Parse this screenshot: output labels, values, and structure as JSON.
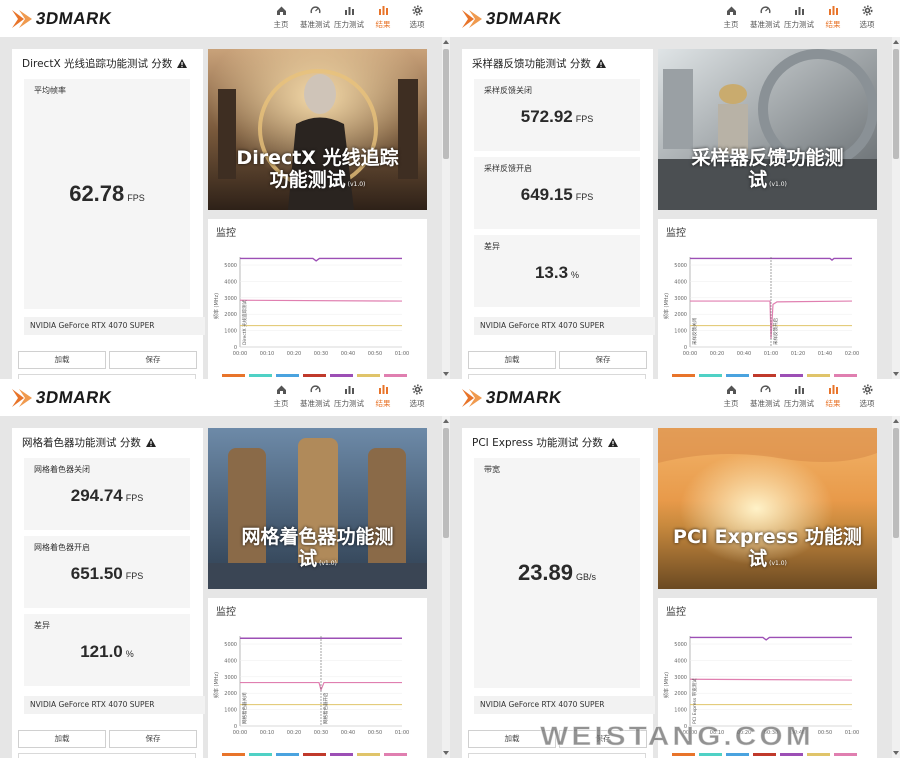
{
  "app_name": "3DMARK",
  "nav": [
    "主页",
    "基准测试",
    "压力测试",
    "结果",
    "选项"
  ],
  "panels": [
    {
      "id": "dxr",
      "score_title": "DirectX 光线追踪功能测试 分数",
      "metrics": [
        {
          "label": "平均帧率",
          "value": "62.78",
          "unit": "FPS"
        }
      ],
      "gpu": "NVIDIA GeForce RTX 4070 SUPER",
      "load": "加载",
      "save": "保存",
      "banner_lines": [
        "DirectX 光线追踪",
        "功能测试"
      ],
      "version": "(v1.0)",
      "monitor_title": "监控",
      "y_label": "频率 (MHz)",
      "y_ticks": [
        "5000",
        "4000",
        "3000",
        "2000",
        "1000",
        "0"
      ],
      "x_ticks": [
        "00:00",
        "00:10",
        "00:20",
        "00:30",
        "00:40",
        "00:50",
        "01:00"
      ],
      "markers": [
        "DirectX 光线追踪测试"
      ]
    },
    {
      "id": "sfb",
      "score_title": "采样器反馈功能测试 分数",
      "metrics": [
        {
          "label": "采样反馈关闭",
          "value": "572.92",
          "unit": "FPS"
        },
        {
          "label": "采样反馈开启",
          "value": "649.15",
          "unit": "FPS"
        },
        {
          "label": "差异",
          "value": "13.3",
          "unit": "%"
        }
      ],
      "gpu": "NVIDIA GeForce RTX 4070 SUPER",
      "load": "加载",
      "save": "保存",
      "banner_lines": [
        "采样器反馈功能测",
        "试"
      ],
      "version": "(v1.0)",
      "monitor_title": "监控",
      "y_label": "频率 (MHz)",
      "y_ticks": [
        "5000",
        "4000",
        "3000",
        "2000",
        "1000",
        "0"
      ],
      "x_ticks": [
        "00:00",
        "00:20",
        "00:40",
        "01:00",
        "01:20",
        "01:40",
        "02:00"
      ],
      "markers": [
        "采样反馈关闭",
        "采样反馈开启"
      ]
    },
    {
      "id": "mesh",
      "score_title": "网格着色器功能测试 分数",
      "metrics": [
        {
          "label": "网格着色器关闭",
          "value": "294.74",
          "unit": "FPS"
        },
        {
          "label": "网格着色器开启",
          "value": "651.50",
          "unit": "FPS"
        },
        {
          "label": "差异",
          "value": "121.0",
          "unit": "%"
        }
      ],
      "gpu": "NVIDIA GeForce RTX 4070 SUPER",
      "load": "加载",
      "save": "保存",
      "banner_lines": [
        "网格着色器功能测",
        "试"
      ],
      "version": "(v1.0)",
      "monitor_title": "监控",
      "y_label": "频率 (MHz)",
      "y_ticks": [
        "5000",
        "4000",
        "3000",
        "2000",
        "1000",
        "0"
      ],
      "x_ticks": [
        "00:00",
        "00:10",
        "00:20",
        "00:30",
        "00:40",
        "00:50",
        "01:00"
      ],
      "markers": [
        "网格着色器关闭",
        "网格着色器开启"
      ]
    },
    {
      "id": "pcie",
      "score_title": "PCI Express 功能测试 分数",
      "metrics": [
        {
          "label": "带宽",
          "value": "23.89",
          "unit": "GB/s"
        }
      ],
      "gpu": "NVIDIA GeForce RTX 4070 SUPER",
      "load": "加载",
      "save": "保存",
      "banner_lines": [
        "PCI Express 功能测",
        "试"
      ],
      "version": "(v1.0)",
      "monitor_title": "监控",
      "y_label": "频率 (MHz)",
      "y_ticks": [
        "5000",
        "4000",
        "3000",
        "2000",
        "1000",
        "0"
      ],
      "x_ticks": [
        "00:00",
        "00:10",
        "00:20",
        "00:30",
        "00:40",
        "00:50",
        "01:00"
      ],
      "markers": [
        "PCI Express 带宽测试"
      ]
    }
  ],
  "colors": {
    "accent": "#e8742a",
    "cpu_clock": "#9c4fb5",
    "gpu_clock": "#e07fb0",
    "mem_clock": "#e0c46a",
    "legend": [
      "#e8742a",
      "#4fd1c5",
      "#4aa3df",
      "#c0392b",
      "#9c4fb5",
      "#e0c46a",
      "#e07fb0"
    ]
  },
  "watermark": "WEISTANG.COM"
}
